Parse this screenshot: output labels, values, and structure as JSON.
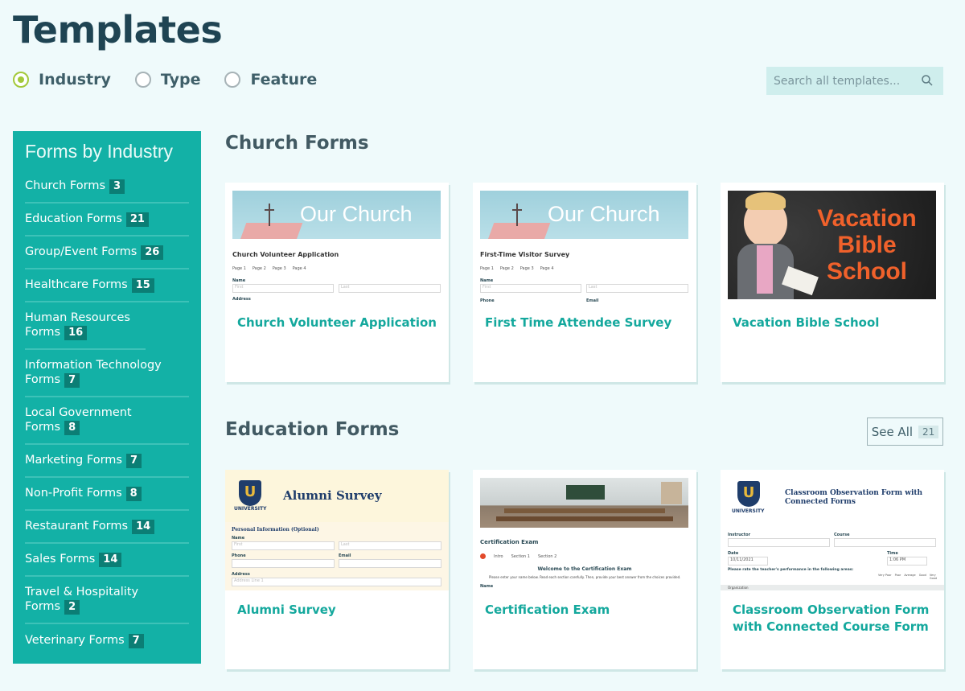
{
  "page": {
    "title": "Templates"
  },
  "filters": [
    {
      "label": "Industry",
      "checked": true
    },
    {
      "label": "Type",
      "checked": false
    },
    {
      "label": "Feature",
      "checked": false
    }
  ],
  "search": {
    "placeholder": "Search all templates..."
  },
  "sidebar": {
    "title": "Forms by Industry",
    "items": [
      {
        "label": "Church Forms",
        "count": "3"
      },
      {
        "label": "Education Forms",
        "count": "21"
      },
      {
        "label": "Group/Event Forms",
        "count": "26"
      },
      {
        "label": "Healthcare Forms",
        "count": "15"
      },
      {
        "label": "Human Resources Forms",
        "count": "16"
      },
      {
        "label": "Information Technology Forms",
        "count": "7"
      },
      {
        "label": "Local Government Forms",
        "count": "8"
      },
      {
        "label": "Marketing Forms",
        "count": "7"
      },
      {
        "label": "Non-Profit Forms",
        "count": "8"
      },
      {
        "label": "Restaurant Forms",
        "count": "14"
      },
      {
        "label": "Sales Forms",
        "count": "14"
      },
      {
        "label": "Travel & Hospitality Forms",
        "count": "2"
      },
      {
        "label": "Veterinary Forms",
        "count": "7"
      }
    ]
  },
  "sections": {
    "church": {
      "title": "Church Forms",
      "cards": [
        {
          "title": "Church Volunteer Application",
          "banner": "Our Church",
          "form_title": "Church Volunteer Application",
          "pages": [
            "Page 1",
            "Page 2",
            "Page 3",
            "Page 4"
          ],
          "field1": "Name",
          "ph1": "First",
          "ph2": "Last",
          "field2": "Address"
        },
        {
          "title": "First Time Attendee Survey",
          "banner": "Our Church",
          "form_title": "First-Time Visitor Survey",
          "pages": [
            "Page 1",
            "Page 2",
            "Page 3",
            "Page 4"
          ],
          "field1": "Name",
          "ph1": "First",
          "ph2": "Last",
          "field2": "Phone",
          "field3": "Email"
        },
        {
          "title": "Vacation Bible School",
          "banner_lines": [
            "Vacation",
            "Bible",
            "School"
          ]
        }
      ]
    },
    "education": {
      "title": "Education Forms",
      "see_all_label": "See All",
      "see_all_count": "21",
      "cards": [
        {
          "title": "Alumni Survey",
          "logo_letter": "U",
          "logo_text": "UNIVERSITY",
          "header": "Alumni Survey",
          "section_label": "Personal Information (Optional)",
          "field1": "Name",
          "ph1": "First",
          "ph2": "Last",
          "field2": "Phone",
          "field3": "Email",
          "field4": "Address",
          "ph4": "Address Line 1"
        },
        {
          "title": "Certification Exam",
          "form_title": "Certification Exam",
          "steps": [
            "Intro",
            "Section 1",
            "Section 2"
          ],
          "welcome": "Welcome to the Certification Exam",
          "instructions": "Please enter your name below. Read each section carefully. Then, provide your best answer from the choices provided.",
          "field1": "Name"
        },
        {
          "title": "Classroom Observation Form with Connected Course Form",
          "logo_letter": "U",
          "logo_text": "UNIVERSITY",
          "header": "Classroom Observation Form with Connected Forms",
          "instructor_label": "Instructor",
          "course_label": "Course",
          "date_label": "Date",
          "date_value": "10/11/2021",
          "time_label": "Time",
          "time_value": "1:06 PM",
          "rate_label": "Please rate the teacher's performance in the following areas:",
          "scale": [
            "Very Poor",
            "Poor",
            "Average",
            "Good",
            "Very Good"
          ],
          "row1": "Organization"
        }
      ]
    }
  },
  "colors": {
    "accent": "#13b1a6",
    "title": "#1f4453",
    "radio_checked": "#a3c93a"
  }
}
